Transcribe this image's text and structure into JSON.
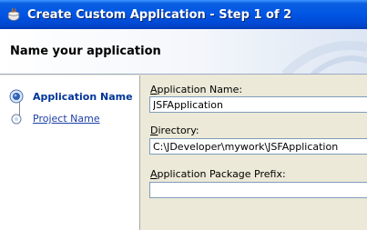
{
  "window": {
    "title": "Create Custom Application - Step 1 of 2",
    "icon": "jdeveloper-cup-icon"
  },
  "header": {
    "heading": "Name your application"
  },
  "steps": [
    {
      "label": "Application Name",
      "state": "current"
    },
    {
      "label": "Project Name",
      "state": "next"
    }
  ],
  "form": {
    "app_name": {
      "label_mnemonic": "A",
      "label_rest": "pplication Name:",
      "value": "JSFApplication"
    },
    "directory": {
      "label_mnemonic": "D",
      "label_rest": "irectory:",
      "value": "C:\\JDeveloper\\mywork\\JSFApplication"
    },
    "package_prefix": {
      "label_mnemonic": "A",
      "label_rest": "pplication Package Prefix:",
      "value": ""
    }
  },
  "colors": {
    "titlebar": "#0055e5",
    "link": "#1c3fa6",
    "current_step": "#003399"
  }
}
